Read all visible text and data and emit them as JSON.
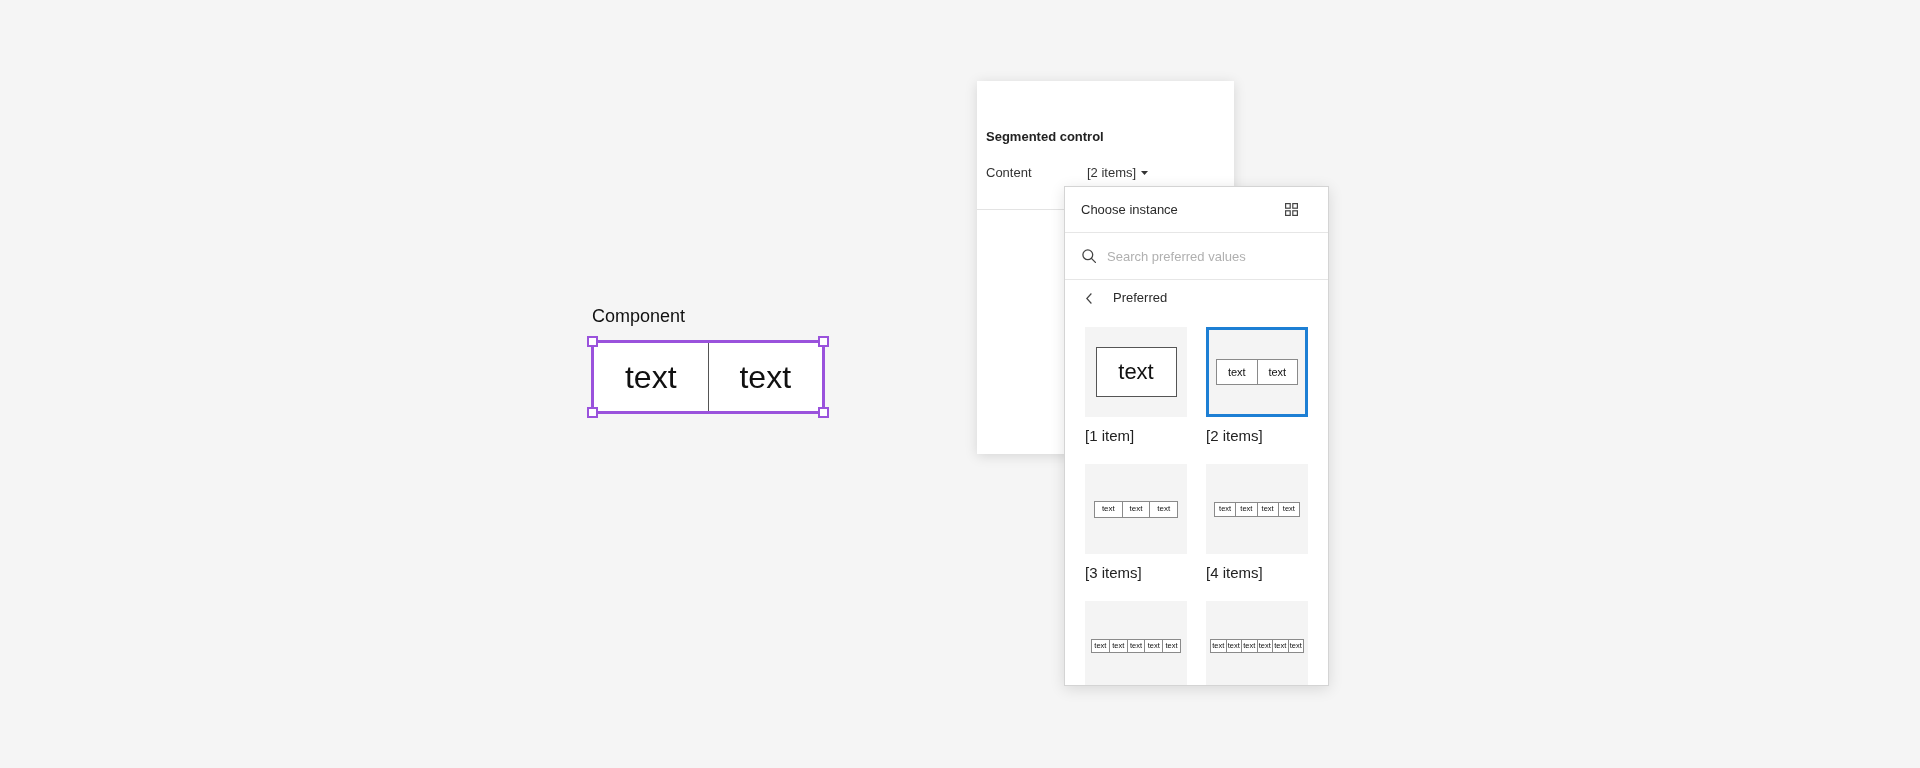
{
  "canvas": {
    "component": {
      "label": "Component",
      "selected": true,
      "segments": [
        "text",
        "text"
      ]
    }
  },
  "properties_panel": {
    "title": "Segmented control",
    "properties": [
      {
        "label": "Content",
        "value": "[2 items]"
      }
    ]
  },
  "instance_picker": {
    "title": "Choose instance",
    "search": {
      "placeholder": "Search preferred values"
    },
    "section": "Preferred",
    "options": [
      {
        "label": "[1 item]",
        "selected": false,
        "segments": [
          "text"
        ]
      },
      {
        "label": "[2 items]",
        "selected": true,
        "segments": [
          "text",
          "text"
        ]
      },
      {
        "label": "[3 items]",
        "selected": false,
        "segments": [
          "text",
          "text",
          "text"
        ]
      },
      {
        "label": "[4 items]",
        "selected": false,
        "segments": [
          "text",
          "text",
          "text",
          "text"
        ]
      },
      {
        "selected": false,
        "segments": [
          "text",
          "text",
          "text",
          "text",
          "text"
        ]
      },
      {
        "selected": false,
        "segments": [
          "text",
          "text",
          "text",
          "text",
          "text",
          "text"
        ]
      }
    ]
  }
}
